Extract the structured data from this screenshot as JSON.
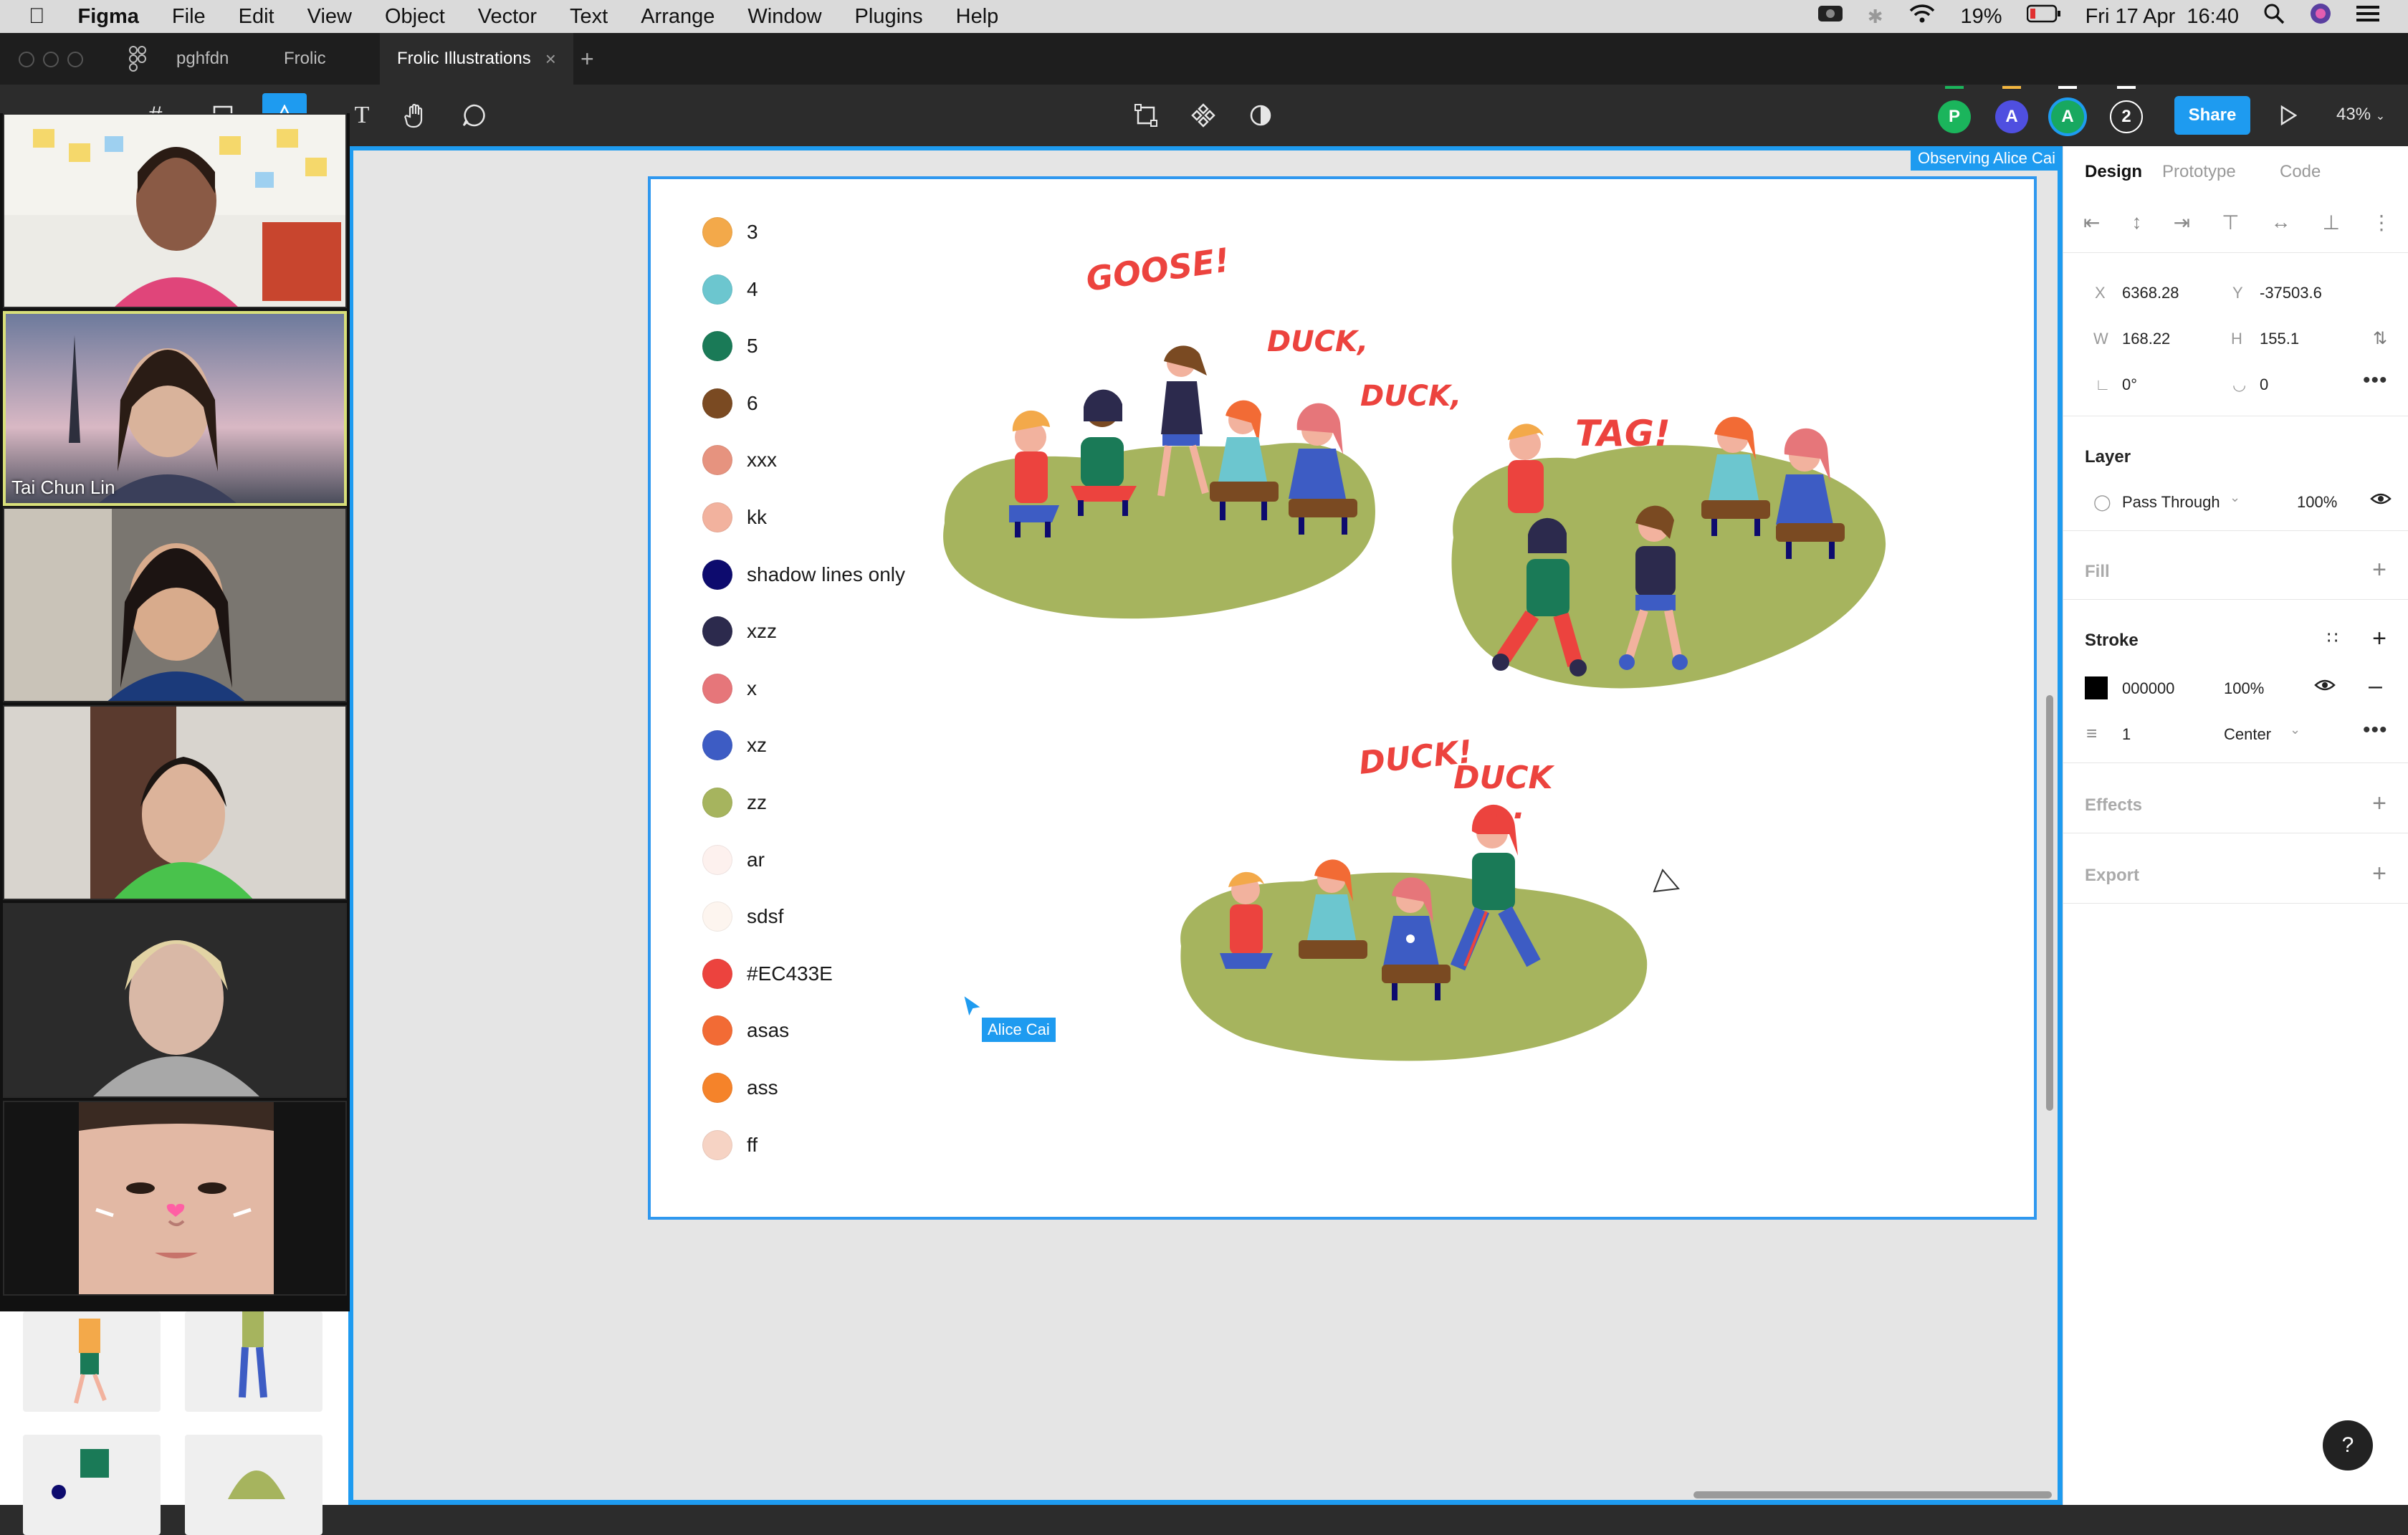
{
  "menubar": {
    "apple": "",
    "app_name": "Figma",
    "items": [
      "File",
      "Edit",
      "View",
      "Object",
      "Vector",
      "Text",
      "Arrange",
      "Window",
      "Plugins",
      "Help"
    ],
    "battery": "19%",
    "datetime": "Fri 17 Apr  16:40"
  },
  "tabs": {
    "items": [
      {
        "label": "pghfdn"
      },
      {
        "label": "Frolic"
      },
      {
        "label": "Frolic Illustrations"
      }
    ],
    "add": "+"
  },
  "toolbar": {
    "collaborators": [
      {
        "initial": "P",
        "color": "#1bb55c"
      },
      {
        "initial": "A",
        "color": "#4f4fe0"
      },
      {
        "initial": "A",
        "color": "#18a860"
      }
    ],
    "extra_count": "2",
    "share_label": "Share",
    "zoom": "43%"
  },
  "observing": "Observing Alice Cai",
  "palette": [
    {
      "label": "3",
      "color": "#f3a94a"
    },
    {
      "label": "4",
      "color": "#6cc6cf"
    },
    {
      "label": "5",
      "color": "#1a7a57"
    },
    {
      "label": "6",
      "color": "#7a4a22"
    },
    {
      "label": "xxx",
      "color": "#e6937f"
    },
    {
      "label": "kk",
      "color": "#f2b29e"
    },
    {
      "label": "shadow lines only",
      "color": "#0d0b6e"
    },
    {
      "label": "xzz",
      "color": "#2c2a4d"
    },
    {
      "label": "x",
      "color": "#e6767a"
    },
    {
      "label": "xz",
      "color": "#3d5cc4"
    },
    {
      "label": "zz",
      "color": "#a6b45e"
    },
    {
      "label": "ar",
      "color": "#fdf1ee"
    },
    {
      "label": "sdsf",
      "color": "#fdf5ef"
    },
    {
      "label": "#EC433E",
      "color": "#ec433e"
    },
    {
      "label": "asas",
      "color": "#f26b35"
    },
    {
      "label": "ass",
      "color": "#f5832a"
    },
    {
      "label": "ff",
      "color": "#f6d3c4"
    }
  ],
  "illustration_texts": {
    "goose": "GOOSE!",
    "duck1": "DUCK,",
    "duck2": "DUCK,",
    "tag": "TAG!",
    "duck3": "DUCK!",
    "duck4": "DUCK",
    "dots": "..."
  },
  "cursor_name": "Alice Cai",
  "panel": {
    "tabs": [
      "Design",
      "Prototype",
      "Code"
    ],
    "x_label": "X",
    "x_value": "6368.28",
    "y_label": "Y",
    "y_value": "-37503.6",
    "w_label": "W",
    "w_value": "168.22",
    "h_label": "H",
    "h_value": "155.1",
    "rotation": "0°",
    "radius": "0",
    "layer_title": "Layer",
    "blend": "Pass Through",
    "opacity": "100%",
    "fill_title": "Fill",
    "stroke_title": "Stroke",
    "stroke_hex": "000000",
    "stroke_opacity": "100%",
    "stroke_weight": "1",
    "stroke_align": "Center",
    "effects_title": "Effects",
    "export_title": "Export",
    "help": "?"
  },
  "video": {
    "participant_name": "Tai Chun Lin"
  }
}
